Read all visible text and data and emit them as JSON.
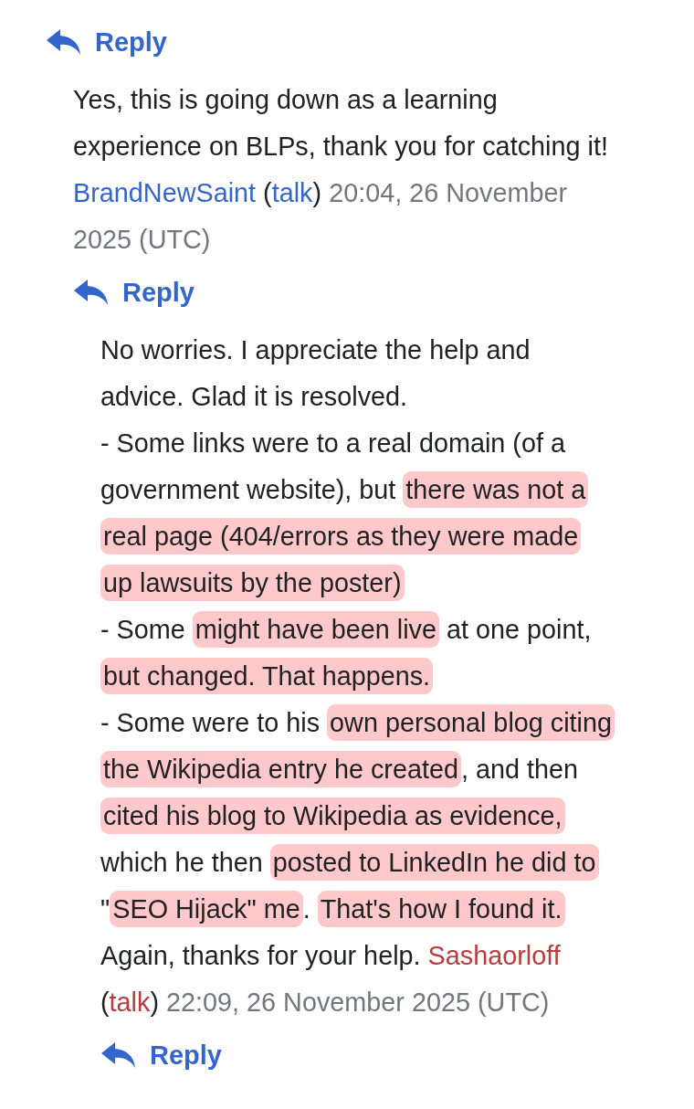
{
  "thread": {
    "reply_label": "Reply",
    "replies": [
      {
        "redlink": false,
        "lines": [
          [
            {
              "kind": "text",
              "parts": [
                {
                  "text": "Yes, this is going down as a learning",
                  "highlighted": false
                }
              ]
            }
          ],
          [
            {
              "kind": "text",
              "parts": [
                {
                  "text": "experience on BLPs, thank you for catching it!",
                  "highlighted": false
                }
              ]
            }
          ],
          [
            {
              "kind": "user",
              "text": "BrandNewSaint"
            },
            {
              "kind": "paren",
              "text": "("
            },
            {
              "kind": "talk",
              "text": "talk"
            },
            {
              "kind": "paren",
              "text": ")"
            },
            {
              "kind": "time",
              "text": "20:04, 26 November"
            }
          ],
          [
            {
              "kind": "time",
              "text": "2025 (UTC)"
            }
          ]
        ],
        "reply_label": "Reply",
        "replies": [
          {
            "redlink": true,
            "lines": [
              [
                {
                  "kind": "text",
                  "parts": [
                    {
                      "text": "No worries. I appreciate the help and",
                      "highlighted": false
                    }
                  ]
                }
              ],
              [
                {
                  "kind": "text",
                  "parts": [
                    {
                      "text": "advice. Glad it is resolved.",
                      "highlighted": false
                    }
                  ]
                }
              ],
              [
                {
                  "kind": "text",
                  "parts": [
                    {
                      "text": "- Some links were to a real domain (of a",
                      "highlighted": false
                    }
                  ]
                }
              ],
              [
                {
                  "kind": "text",
                  "parts": [
                    {
                      "text": "government website), but ",
                      "highlighted": false
                    },
                    {
                      "text": "there was not a",
                      "highlighted": true
                    }
                  ]
                }
              ],
              [
                {
                  "kind": "text",
                  "parts": [
                    {
                      "text": "real page (404/errors as they were made",
                      "highlighted": true
                    }
                  ]
                }
              ],
              [
                {
                  "kind": "text",
                  "parts": [
                    {
                      "text": "up lawsuits by the poster)",
                      "highlighted": true
                    }
                  ]
                }
              ],
              [
                {
                  "kind": "text",
                  "parts": [
                    {
                      "text": "- Some ",
                      "highlighted": false
                    },
                    {
                      "text": "might have been live",
                      "highlighted": true
                    },
                    {
                      "text": " at one point,",
                      "highlighted": false
                    }
                  ]
                }
              ],
              [
                {
                  "kind": "text",
                  "parts": [
                    {
                      "text": "but changed. That happens.",
                      "highlighted": true
                    }
                  ]
                }
              ],
              [
                {
                  "kind": "text",
                  "parts": [
                    {
                      "text": "- Some were to his ",
                      "highlighted": false
                    },
                    {
                      "text": "own personal blog citing",
                      "highlighted": true
                    }
                  ]
                }
              ],
              [
                {
                  "kind": "text",
                  "parts": [
                    {
                      "text": "the Wikipedia entry he created",
                      "highlighted": true
                    },
                    {
                      "text": ", and then",
                      "highlighted": false
                    }
                  ]
                }
              ],
              [
                {
                  "kind": "text",
                  "parts": [
                    {
                      "text": "cited his blog to Wikipedia as evidence,",
                      "highlighted": true
                    }
                  ]
                }
              ],
              [
                {
                  "kind": "text",
                  "parts": [
                    {
                      "text": "which he then ",
                      "highlighted": false
                    },
                    {
                      "text": "posted to LinkedIn he did to",
                      "highlighted": true
                    }
                  ]
                }
              ],
              [
                {
                  "kind": "text",
                  "parts": [
                    {
                      "text": "\"",
                      "highlighted": false
                    },
                    {
                      "text": "SEO Hijack\" me",
                      "highlighted": true
                    },
                    {
                      "text": ". ",
                      "highlighted": false
                    },
                    {
                      "text": "That's how I found it.",
                      "highlighted": true
                    }
                  ]
                }
              ],
              [
                {
                  "kind": "text",
                  "parts": [
                    {
                      "text": "Again, thanks for your help. ",
                      "highlighted": false
                    }
                  ]
                },
                {
                  "kind": "user",
                  "text": "Sashaorloff"
                }
              ],
              [
                {
                  "kind": "paren",
                  "text": "("
                },
                {
                  "kind": "talk",
                  "text": "talk"
                },
                {
                  "kind": "paren",
                  "text": ")"
                },
                {
                  "kind": "time",
                  "text": "22:09, 26 November 2025 (UTC)"
                }
              ]
            ],
            "reply_label": "Reply"
          }
        ]
      }
    ]
  }
}
